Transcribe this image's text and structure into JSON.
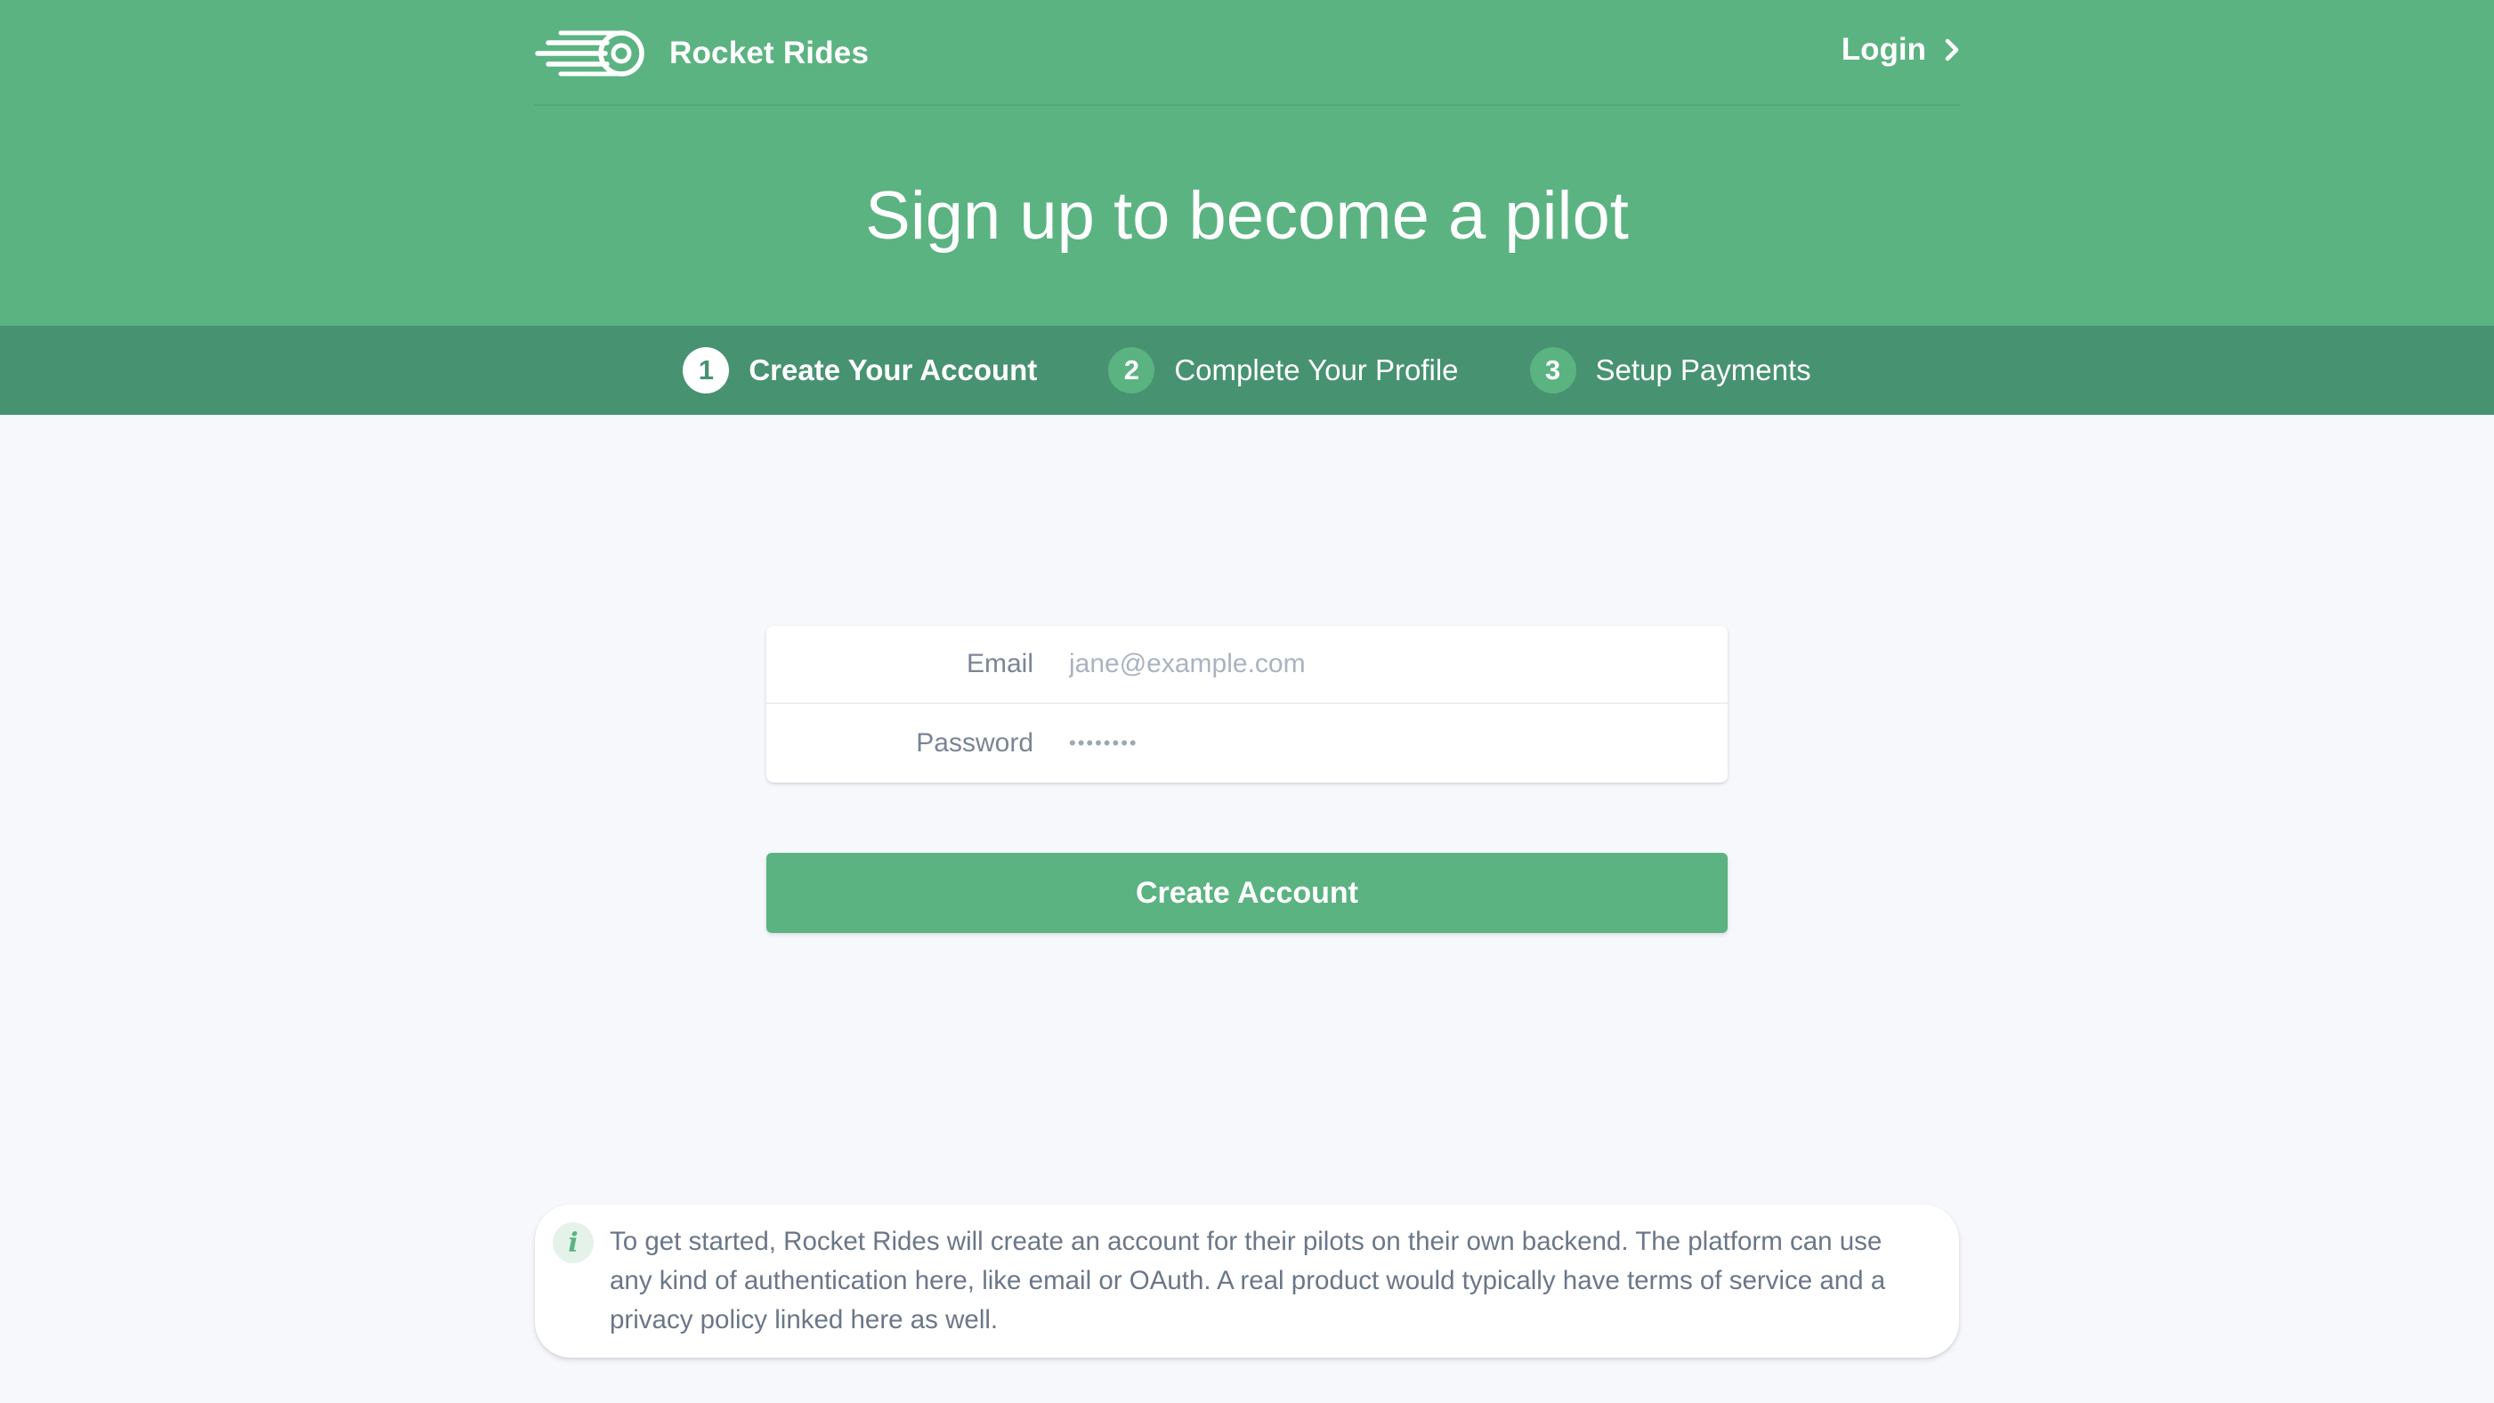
{
  "colors": {
    "brand_green": "#5bb381",
    "steps_bar_green": "#479271",
    "background": "#f7f8fb",
    "text_muted": "#6b7788"
  },
  "header": {
    "logo_icon": "rocket-speed-icon",
    "brand_name": "Rocket Rides",
    "login_label": "Login",
    "login_icon": "chevron-right-icon",
    "title": "Sign up to become a pilot"
  },
  "steps": [
    {
      "number": "1",
      "label": "Create Your Account",
      "active": true
    },
    {
      "number": "2",
      "label": "Complete Your Profile",
      "active": false
    },
    {
      "number": "3",
      "label": "Setup Payments",
      "active": false
    }
  ],
  "form": {
    "email_label": "Email",
    "email_placeholder": "jane@example.com",
    "email_value": "",
    "password_label": "Password",
    "password_value": "••••••••",
    "submit_label": "Create Account"
  },
  "info": {
    "icon": "info-icon",
    "icon_glyph": "i",
    "text": "To get started, Rocket Rides will create an account for their pilots on their own backend. The platform can use any kind of authentication here, like email or OAuth. A real product would typically have terms of service and a privacy policy linked here as well."
  }
}
